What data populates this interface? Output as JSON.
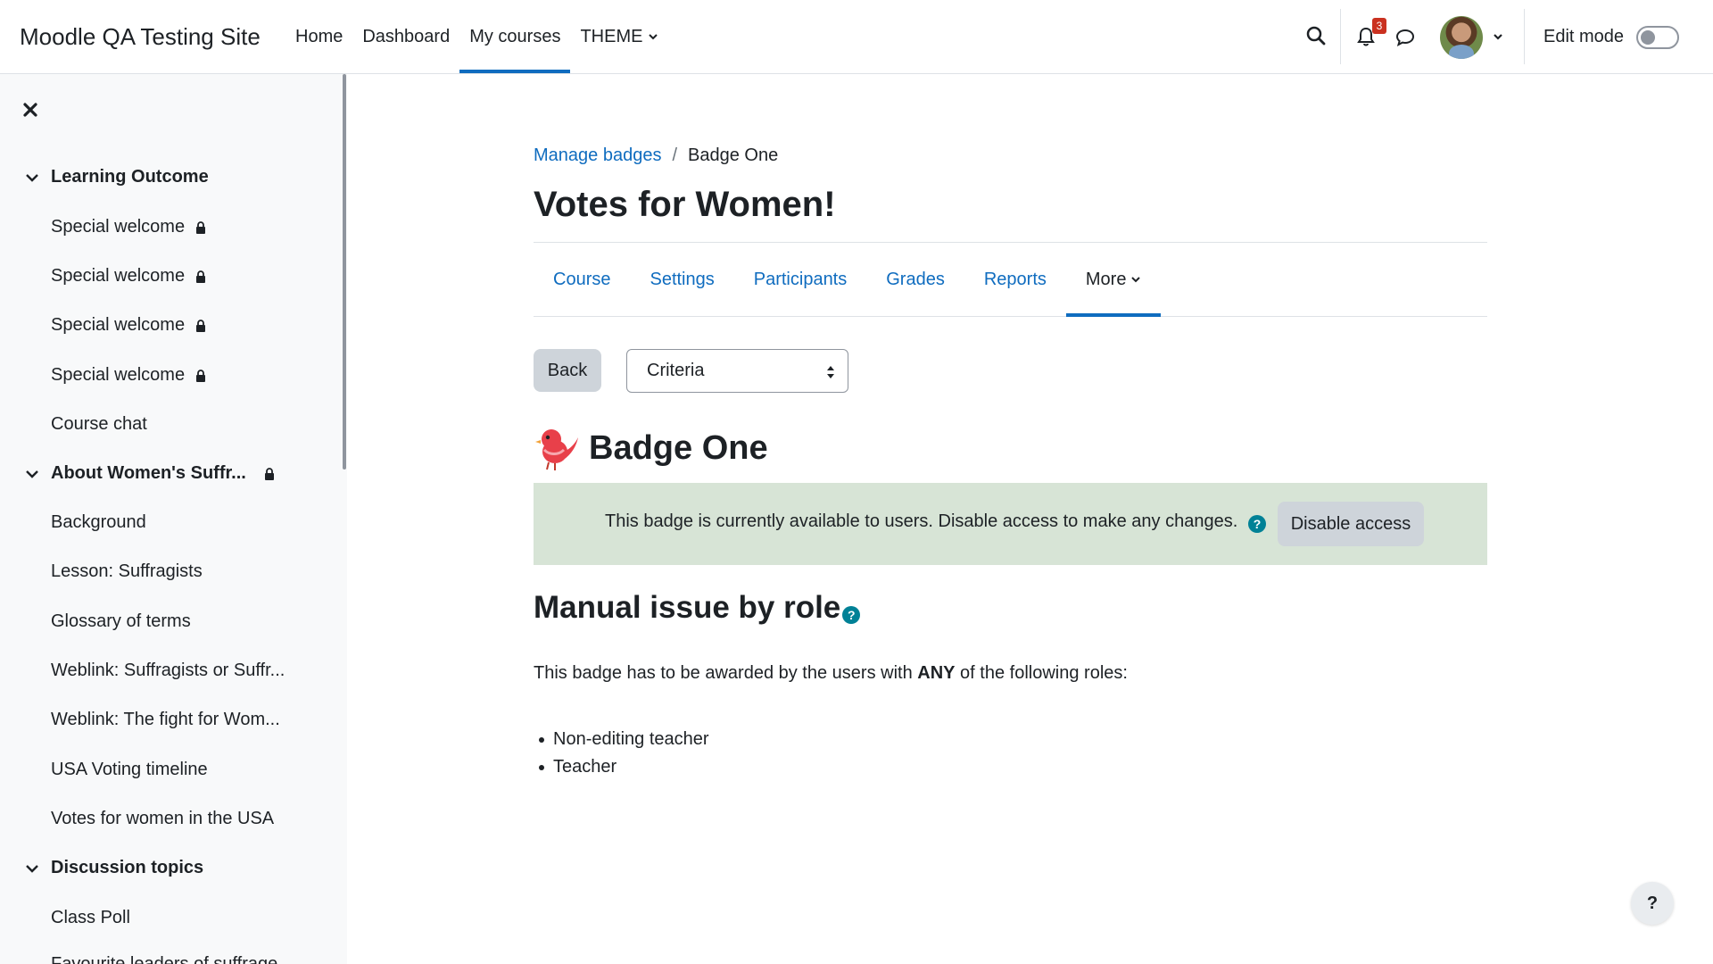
{
  "site": {
    "name": "Moodle QA Testing Site"
  },
  "primary_nav": {
    "items": [
      {
        "label": "Home"
      },
      {
        "label": "Dashboard"
      },
      {
        "label": "My courses"
      },
      {
        "label": "THEME"
      }
    ],
    "active": "My courses"
  },
  "header_right": {
    "notifications_count": "3",
    "edit_mode_label": "Edit mode",
    "edit_mode_on": false,
    "icons": [
      "search-icon",
      "bell-icon",
      "chat-icon",
      "avatar",
      "chevron-down-icon"
    ]
  },
  "drawer": {
    "sections": [
      {
        "title": "Learning Outcome",
        "items": [
          {
            "label": "Special welcome",
            "locked": true
          },
          {
            "label": "Special welcome",
            "locked": true
          },
          {
            "label": "Special welcome",
            "locked": true
          },
          {
            "label": "Special welcome",
            "locked": true
          },
          {
            "label": "Course chat",
            "locked": false
          }
        ]
      },
      {
        "title": "About Women's Suffr...",
        "locked": true,
        "items": [
          {
            "label": "Background"
          },
          {
            "label": "Lesson: Suffragists"
          },
          {
            "label": "Glossary of terms"
          },
          {
            "label": "Weblink: Suffragists or Suffr..."
          },
          {
            "label": "Weblink: The fight for Wom..."
          },
          {
            "label": "USA Voting timeline"
          },
          {
            "label": "Votes for women in the USA"
          }
        ]
      },
      {
        "title": "Discussion topics",
        "items": [
          {
            "label": "Class Poll"
          },
          {
            "label": "Favourite leaders of suffrage"
          }
        ]
      }
    ]
  },
  "breadcrumb": {
    "parent": "Manage badges",
    "separator": "/",
    "current": "Badge One"
  },
  "page_title": "Votes for Women!",
  "secondary_nav": {
    "tabs": [
      "Course",
      "Settings",
      "Participants",
      "Grades",
      "Reports",
      "More"
    ],
    "active": "More"
  },
  "actions": {
    "back_label": "Back",
    "select_value": "Criteria"
  },
  "badge": {
    "name": "Badge One"
  },
  "alert": {
    "text": "This badge is currently available to users. Disable access to make any changes.",
    "button": "Disable access",
    "color": "#d7e4d6"
  },
  "criteria": {
    "heading": "Manual issue by role",
    "desc_before": "This badge has to be awarded by the users with ",
    "desc_bold": "ANY",
    "desc_after": " of the following roles:",
    "roles": [
      "Non-editing teacher",
      "Teacher"
    ]
  },
  "help_button": "?",
  "colors": {
    "accent": "#0f6cbf",
    "help": "#008196",
    "badge_red": "#e8404a"
  }
}
